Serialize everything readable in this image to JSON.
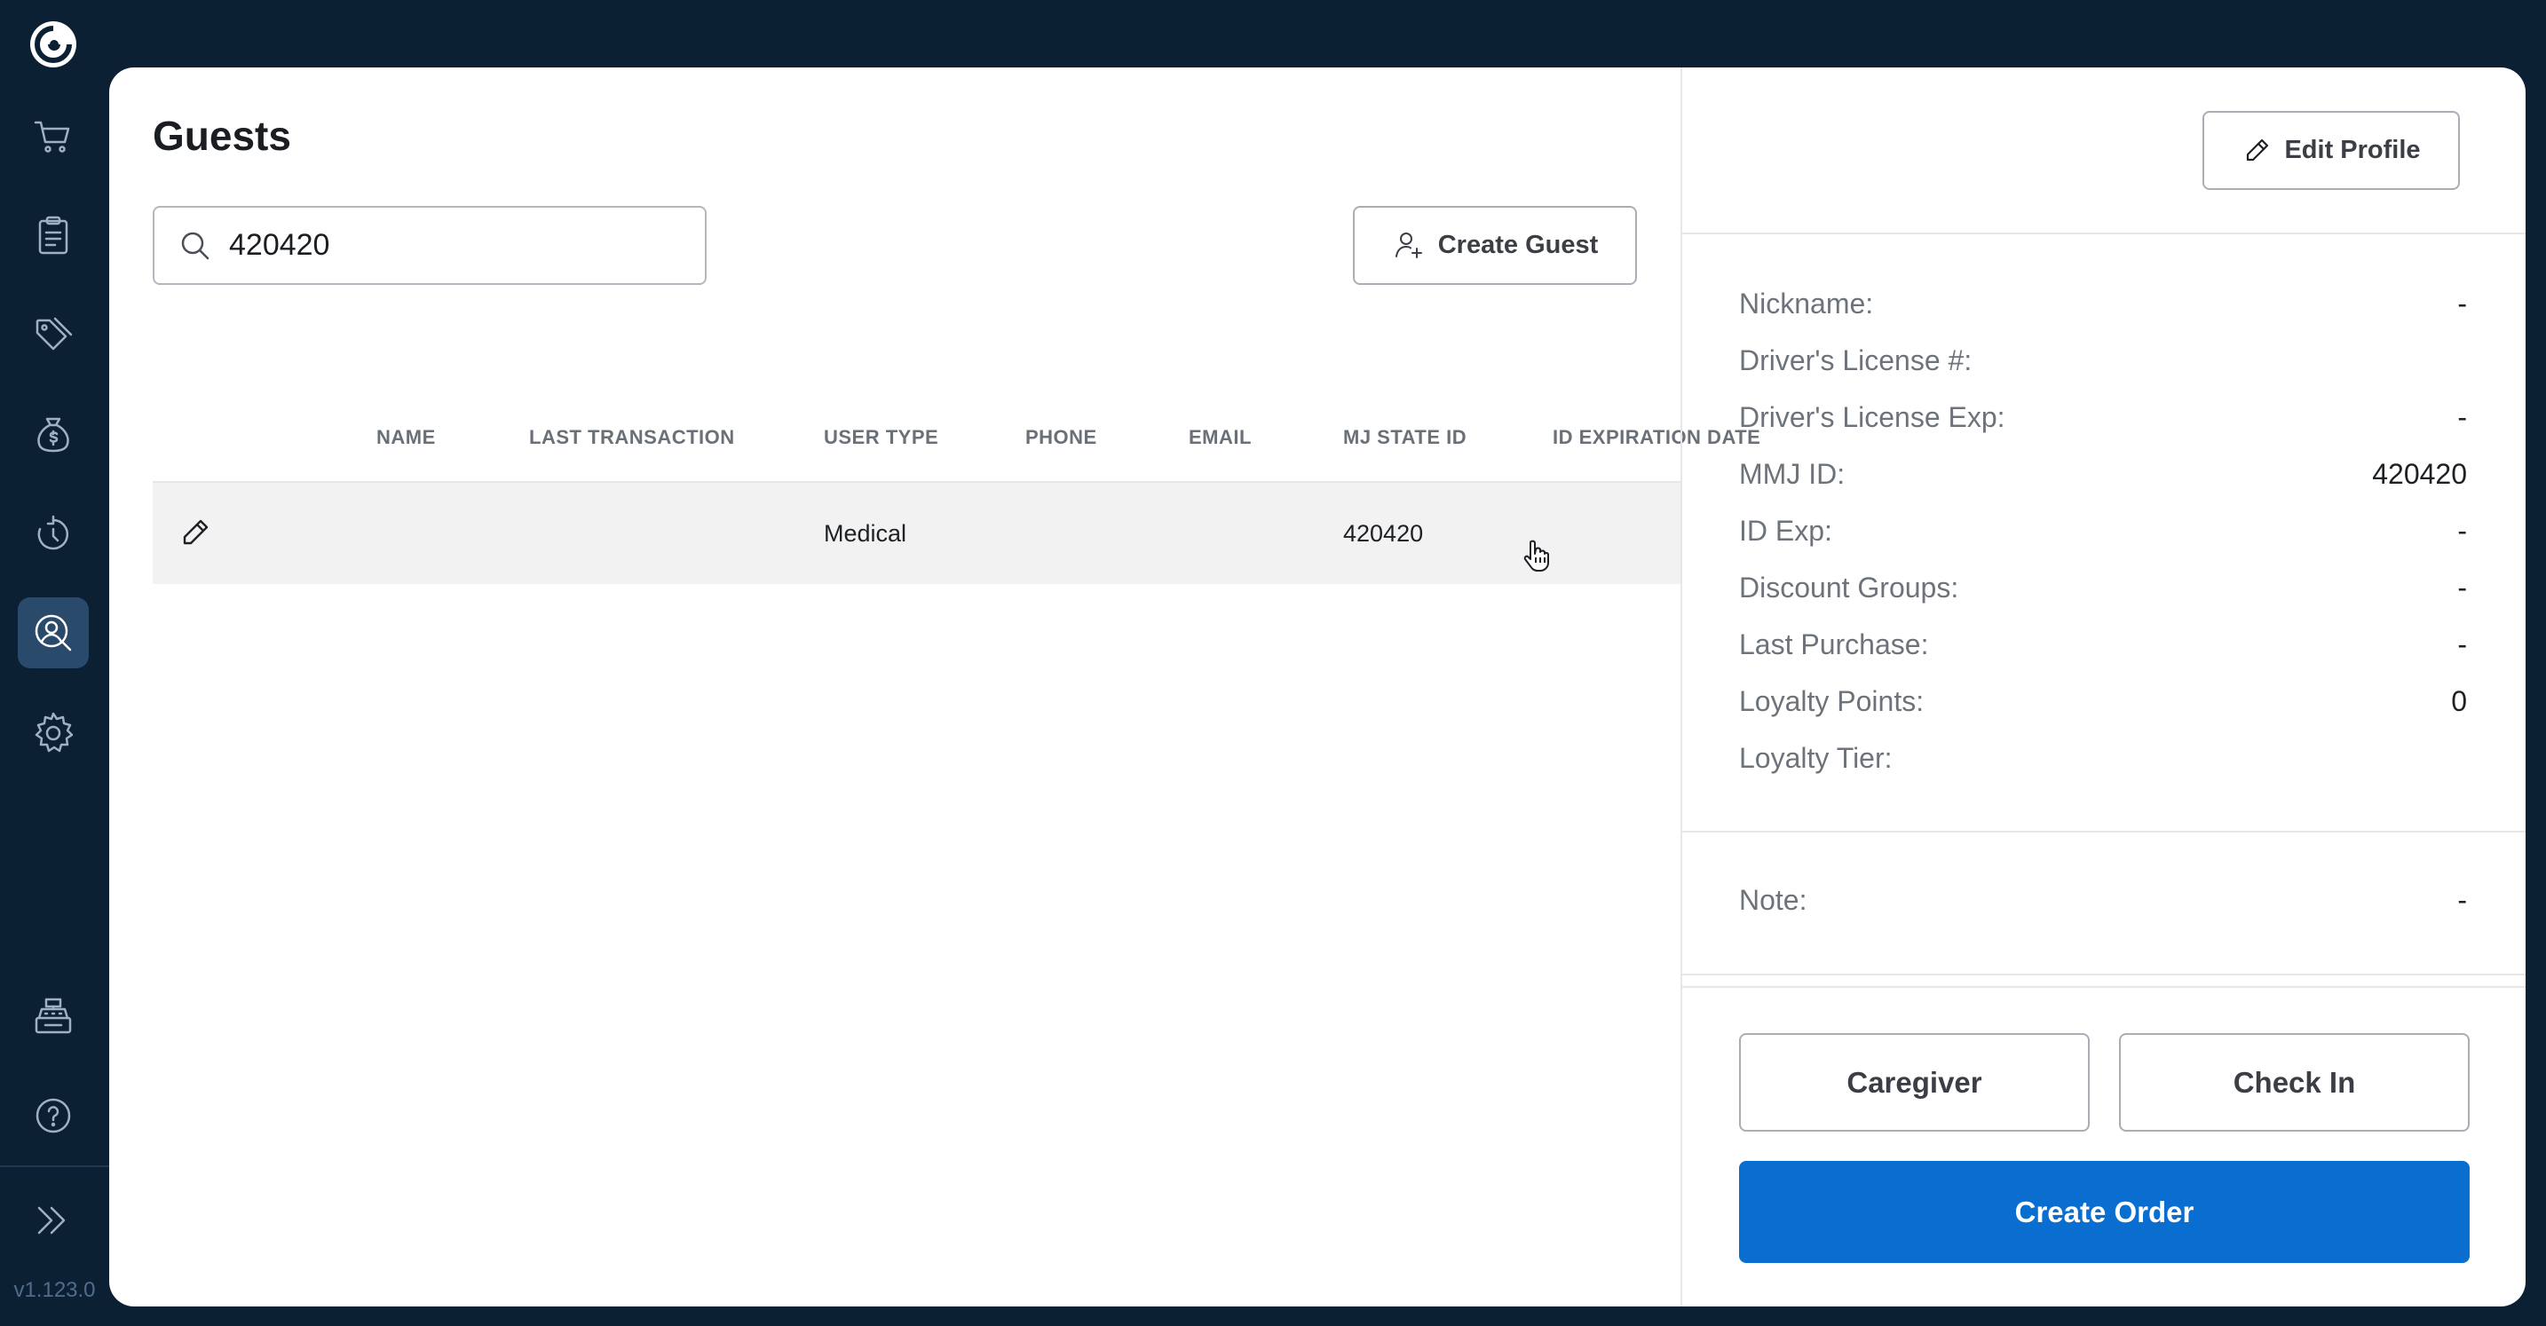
{
  "app": {
    "version": "v1.123.0"
  },
  "sidebar": {
    "items": [
      {
        "icon": "cart-icon",
        "active": false
      },
      {
        "icon": "clipboard-list-icon",
        "active": false
      },
      {
        "icon": "tags-icon",
        "active": false
      },
      {
        "icon": "money-bag-icon",
        "active": false
      },
      {
        "icon": "history-icon",
        "active": false
      },
      {
        "icon": "guest-search-icon",
        "active": true
      },
      {
        "icon": "gear-icon",
        "active": false
      },
      {
        "icon": "cash-register-icon",
        "active": false
      },
      {
        "icon": "help-icon",
        "active": false
      },
      {
        "icon": "expand-chevrons-icon",
        "active": false
      }
    ],
    "active_color": "#294a6b"
  },
  "guests": {
    "title": "Guests",
    "search": {
      "value": "420420",
      "placeholder": ""
    },
    "create_guest_label": "Create Guest",
    "columns": [
      "NAME",
      "LAST TRANSACTION",
      "USER TYPE",
      "PHONE",
      "EMAIL",
      "MJ STATE ID",
      "ID EXPIRATION DATE"
    ],
    "rows": [
      {
        "name": "",
        "last_transaction": "",
        "user_type": "Medical",
        "phone": "",
        "email": "",
        "mj_state_id": "420420",
        "id_expiration_date": ""
      }
    ]
  },
  "profile": {
    "edit_profile_label": "Edit Profile",
    "fields": [
      {
        "label": "Nickname:",
        "value": "-"
      },
      {
        "label": "Driver's License #:",
        "value": ""
      },
      {
        "label": "Driver's License Exp:",
        "value": "-"
      },
      {
        "label": "MMJ ID:",
        "value": "420420"
      },
      {
        "label": "ID Exp:",
        "value": "-"
      },
      {
        "label": "Discount Groups:",
        "value": "-"
      },
      {
        "label": "Last Purchase:",
        "value": "-"
      },
      {
        "label": "Loyalty Points:",
        "value": "0"
      },
      {
        "label": "Loyalty Tier:",
        "value": ""
      }
    ],
    "note": {
      "label": "Note:",
      "value": "-"
    },
    "caregiver_label": "Caregiver",
    "check_in_label": "Check In",
    "create_order_label": "Create Order"
  },
  "colors": {
    "sidebar_bg": "#0c2034",
    "primary": "#0a6ed1",
    "row_highlight": "#f2f2f2"
  }
}
